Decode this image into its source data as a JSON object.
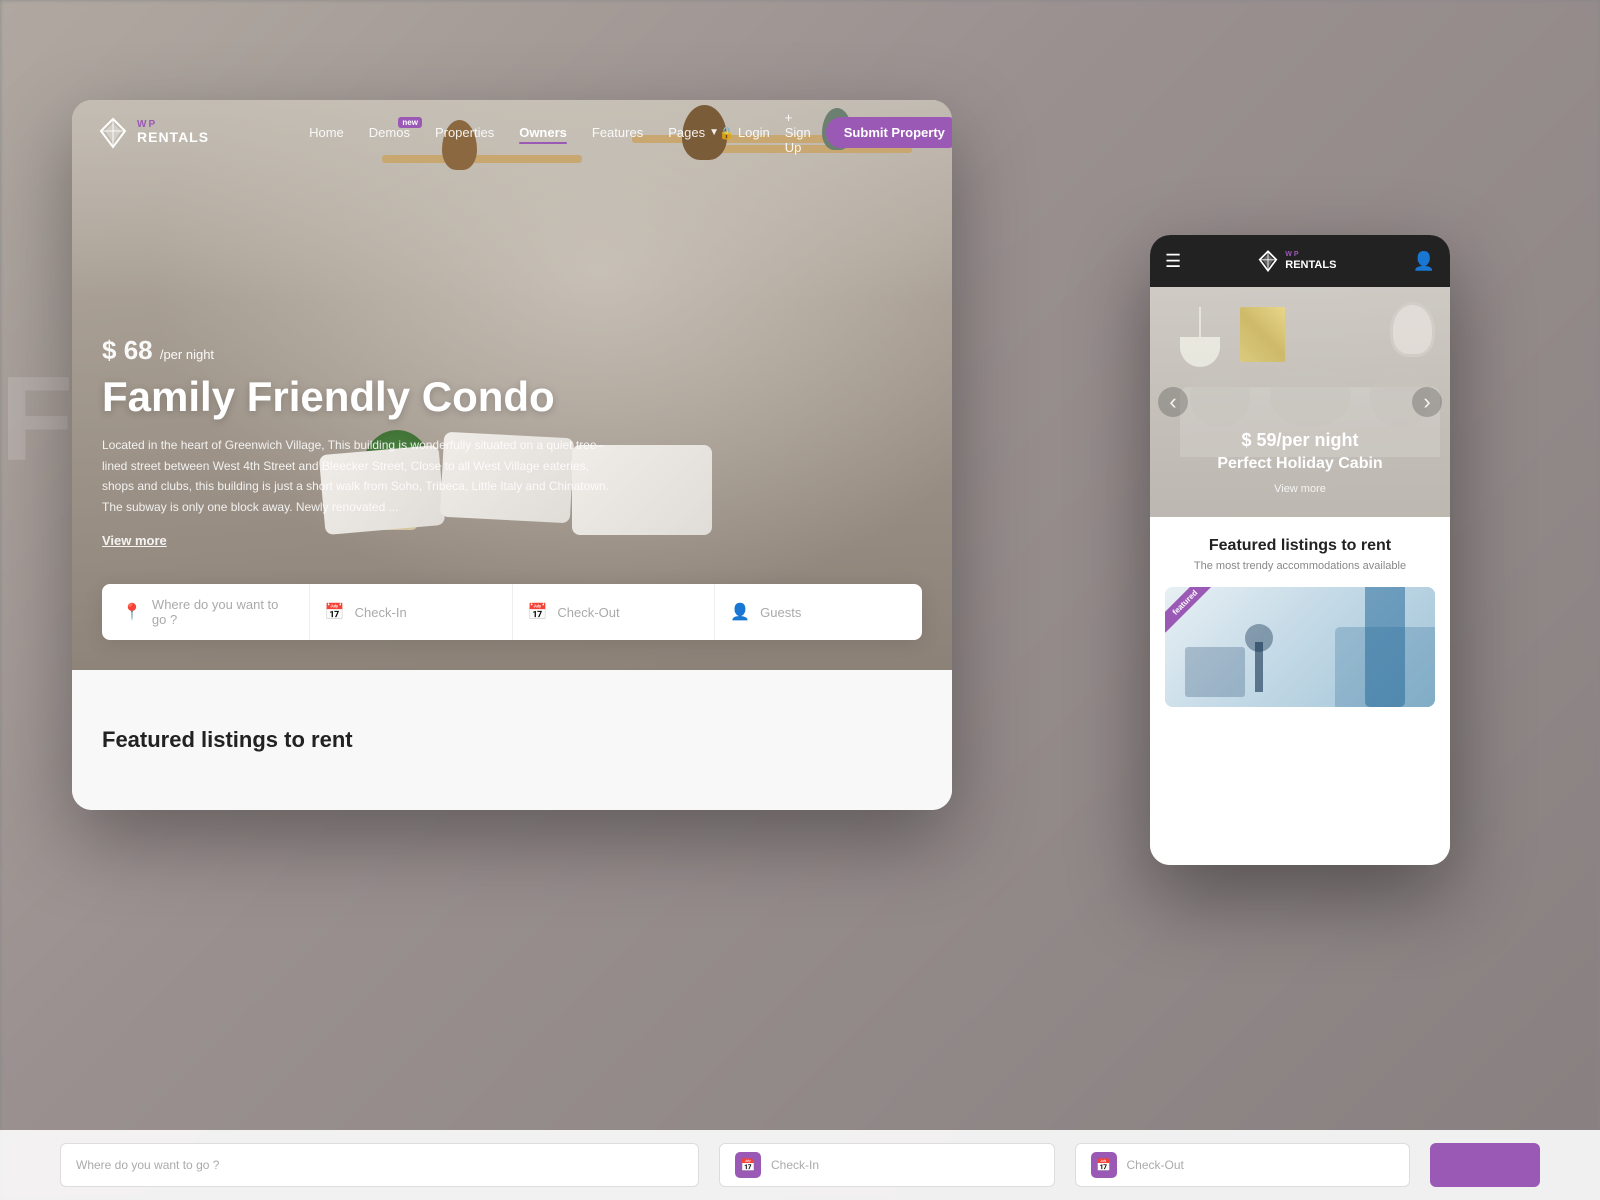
{
  "brand": {
    "wp_label": "WP",
    "rentals_label": "RENTALS",
    "mobile_wp": "WP",
    "mobile_rentals": "RENTALS"
  },
  "nav": {
    "links": [
      {
        "id": "home",
        "label": "Home",
        "active": false
      },
      {
        "id": "demos",
        "label": "Demos",
        "active": false,
        "badge": "new"
      },
      {
        "id": "properties",
        "label": "Properties",
        "active": false
      },
      {
        "id": "owners",
        "label": "Owners",
        "active": true
      },
      {
        "id": "features",
        "label": "Features",
        "active": false
      },
      {
        "id": "pages",
        "label": "Pages",
        "active": false
      }
    ],
    "login_label": "Login",
    "signup_label": "+ Sign Up",
    "submit_label": "Submit Property"
  },
  "hero": {
    "price_prefix": "$ ",
    "price_amount": "68",
    "price_unit": "/per night",
    "title": "Family Friendly Condo",
    "description": "Located in the heart of Greenwich Village, This building is wonderfully situated on a quiet tree–lined street between West 4th Street and Bleecker Street, Close to all West Village eateries, shops and clubs, this building is just a short walk from Soho, Tribeca, Little Italy and Chinatown. The subway is only one block away. Newly renovated ...",
    "view_more": "View more"
  },
  "search": {
    "location_placeholder": "Where do you want to go ?",
    "checkin_placeholder": "Check-In",
    "checkout_placeholder": "Check-Out",
    "guests_placeholder": "Guests"
  },
  "featured": {
    "title": "Featured listings to rent",
    "subtitle": "The most trendy accommodations available"
  },
  "mobile": {
    "price_prefix": "$ ",
    "price_amount": "59",
    "price_unit": "/per night",
    "cabin_title": "Perfect Holiday Cabin",
    "view_more": "View more",
    "listing_badge": "featured",
    "featured_title": "Featured listings to rent",
    "featured_subtitle": "The most trendy accommodations available"
  },
  "colors": {
    "brand_purple": "#9b59b6",
    "nav_active_underline": "#9b59b6",
    "text_primary": "#222",
    "text_muted": "#888"
  }
}
